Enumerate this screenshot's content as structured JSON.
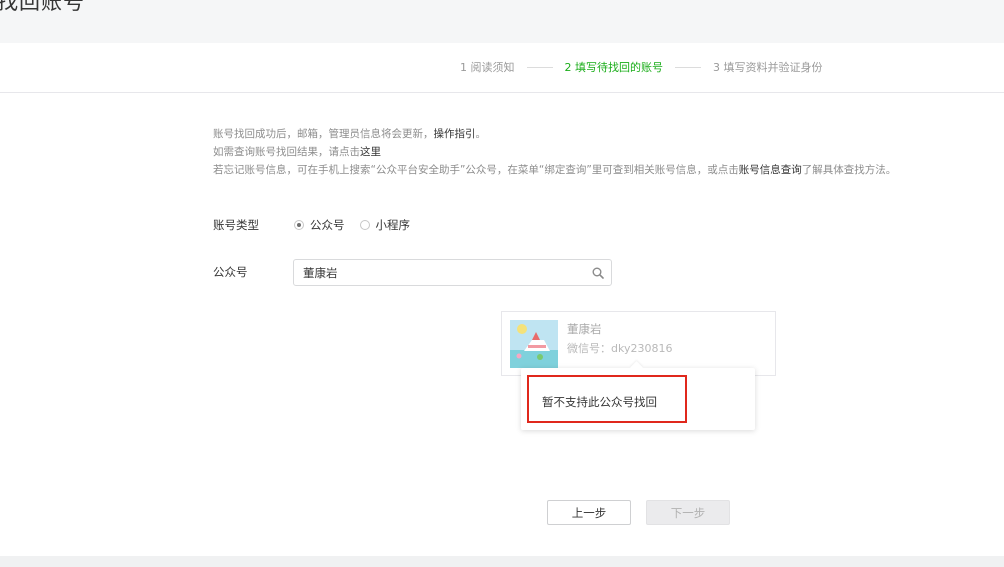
{
  "page": {
    "title": "找回账号"
  },
  "steps": [
    {
      "label": "1 阅读须知",
      "state": "done"
    },
    {
      "label": "2 填写待找回的账号",
      "state": "active"
    },
    {
      "label": "3 填写资料并验证身份",
      "state": "todo"
    }
  ],
  "tips": {
    "line1_text": "账号找回成功后，邮箱，管理员信息将会更新，",
    "line1_link": "操作指引",
    "line1_end": "。",
    "line2_text": "如需查询账号找回结果，请点击",
    "line2_link": "这里",
    "line3_text": "若忘记账号信息，可在手机上搜索“公众平台安全助手”公众号，在菜单“绑定查询”里可查到相关账号信息，或点击",
    "line3_link": "账号信息查询",
    "line3_end": "了解具体查找方法。"
  },
  "form": {
    "account_type_label": "账号类型",
    "options": [
      {
        "label": "公众号",
        "checked": true
      },
      {
        "label": "小程序",
        "checked": false
      }
    ],
    "account_label": "公众号",
    "search_value": "董康岩"
  },
  "result": {
    "name": "董康岩",
    "wechat_id": "微信号：dky230816"
  },
  "popover": {
    "message": "暂不支持此公众号找回"
  },
  "buttons": {
    "prev": "上一步",
    "next": "下一步"
  },
  "colors": {
    "accent": "#1aad19",
    "highlight": "#e0281c"
  },
  "icons": {
    "search": "search-icon"
  }
}
